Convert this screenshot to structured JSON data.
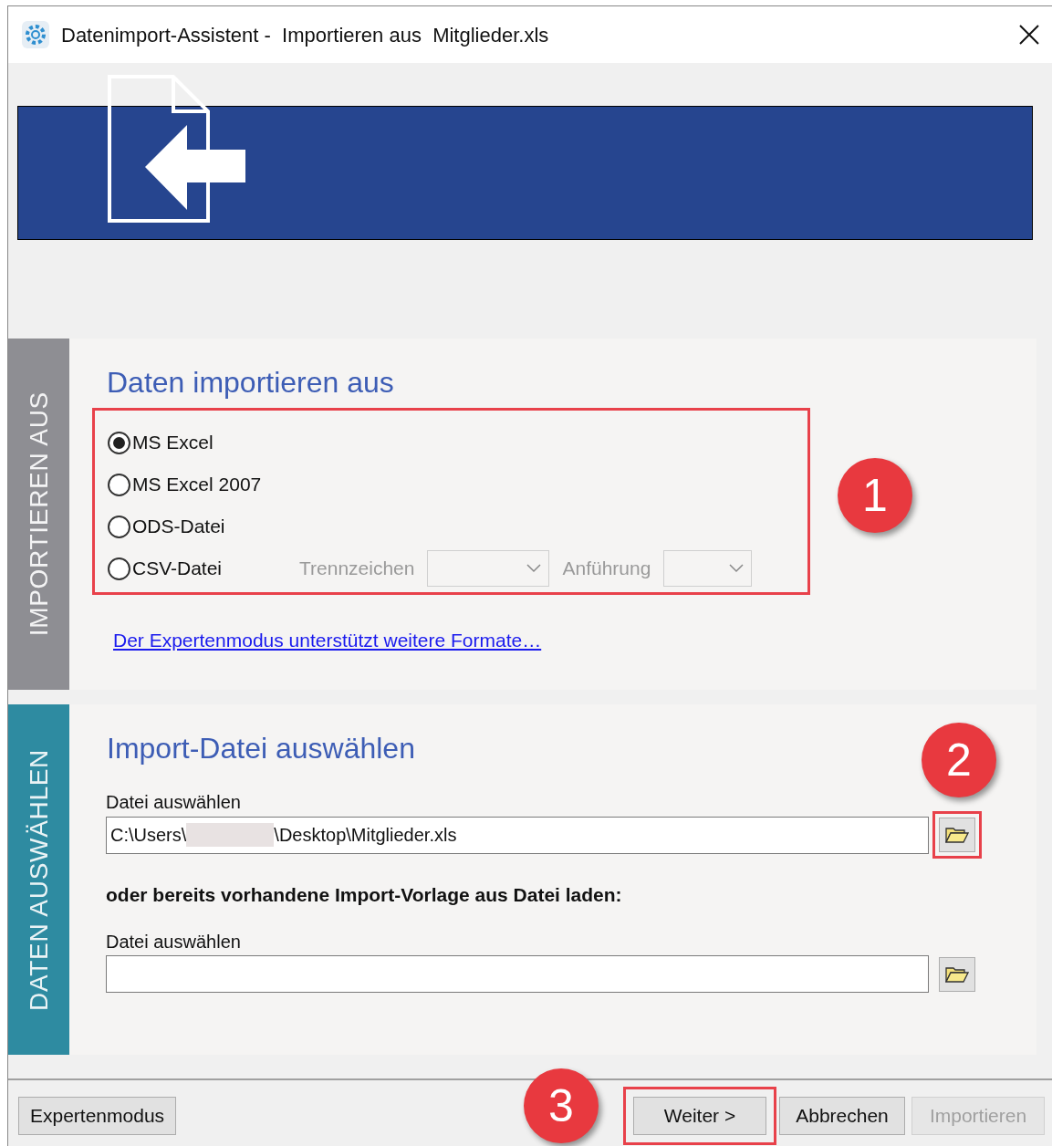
{
  "window": {
    "title": "Datenimport-Assistent -  Importieren aus  Mitglieder.xls"
  },
  "sections": [
    {
      "tab_label": "IMPORTIEREN AUS",
      "kind": "source",
      "heading": "Daten importieren aus",
      "highlighted": true,
      "options": [
        {
          "label": "MS Excel",
          "selected": true
        },
        {
          "label": "MS Excel 2007",
          "selected": false
        },
        {
          "label": "ODS-Datei",
          "selected": false
        },
        {
          "label": "CSV-Datei",
          "selected": false
        }
      ],
      "csv_settings": [
        {
          "label": "Trennzeichen",
          "disabled": true
        },
        {
          "label": "Anführung",
          "disabled": true
        }
      ],
      "link": "Der Expertenmodus unterstützt weitere Formate…"
    },
    {
      "tab_label": "DATEN AUSWÄHLEN",
      "kind": "file",
      "heading": "Import-Datei auswählen",
      "fields": [
        {
          "label": "Datei auswählen",
          "value_before": "C:\\Users\\",
          "redacted": true,
          "value_after": "\\Desktop\\Mitglieder.xls",
          "highlighted": true
        },
        {
          "note": "oder bereits vorhandene Import-Vorlage aus Datei laden:",
          "label": "Datei auswählen",
          "highlighted": false
        }
      ]
    }
  ],
  "buttons": [
    {
      "label": "Expertenmodus",
      "disabled": false,
      "highlighted": false
    },
    {
      "label": "Weiter >",
      "disabled": false,
      "highlighted": true
    },
    {
      "label": "Abbrechen",
      "disabled": false,
      "highlighted": false
    },
    {
      "label": "Importieren",
      "disabled": true,
      "highlighted": false
    }
  ],
  "callouts": [
    {
      "number": "1"
    },
    {
      "number": "2"
    },
    {
      "number": "3"
    }
  ]
}
